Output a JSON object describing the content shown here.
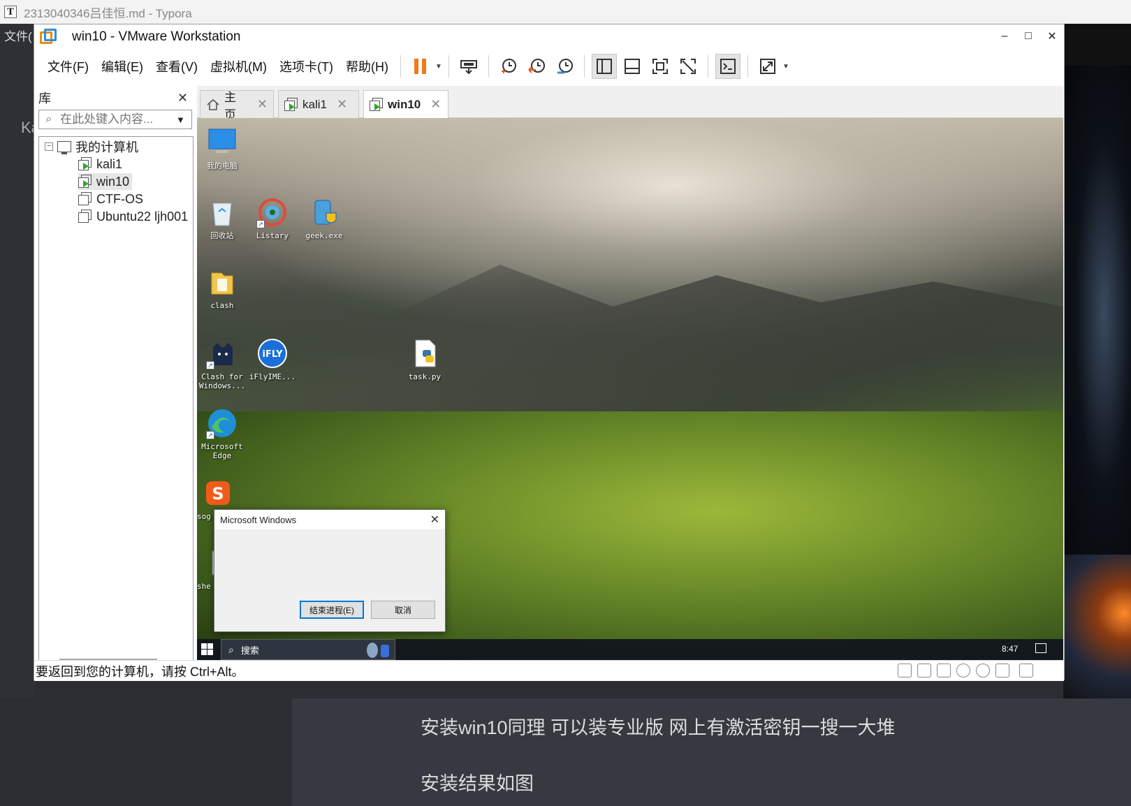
{
  "typora": {
    "window_title": "2313040346吕佳恒.md - Typora",
    "menu_file": "文件(",
    "side_partial": "Ka",
    "doc_line1": "安装win10同理 可以装专业版 网上有激活密钥一搜一大堆",
    "doc_line2": "安装结果如图"
  },
  "vmware": {
    "title": "win10 - VMware Workstation",
    "window_controls": {
      "minimize": "–",
      "maximize": "□",
      "close": "✕"
    },
    "menu": [
      "文件(F)",
      "编辑(E)",
      "查看(V)",
      "虚拟机(M)",
      "选项卡(T)",
      "帮助(H)"
    ],
    "toolbar_icons": [
      "pause-icon",
      "send-ctrl-alt-del-icon",
      "snapshot-take-icon",
      "snapshot-revert-icon",
      "snapshot-manager-icon",
      "show-library-icon",
      "thumbnail-bar-icon",
      "full-screen-icon",
      "unity-icon",
      "console-view-icon",
      "stretch-guest-icon"
    ],
    "library": {
      "title": "库",
      "close": "✕",
      "search_placeholder": "在此处键入内容...",
      "tree": {
        "root": "我的计算机",
        "items": [
          {
            "label": "kali1",
            "running": true
          },
          {
            "label": "win10",
            "running": true,
            "selected": true
          },
          {
            "label": "CTF-OS",
            "running": false
          },
          {
            "label": "Ubuntu22 ljh001",
            "running": false
          }
        ]
      }
    },
    "tabs": [
      {
        "label": "主页",
        "icon": "home-icon",
        "active": false
      },
      {
        "label": "kali1",
        "icon": "vm-running-icon",
        "active": false
      },
      {
        "label": "win10",
        "icon": "vm-running-icon",
        "active": true
      }
    ],
    "tab_close": "✕",
    "status_text": "要返回到您的计算机，请按 Ctrl+Alt。"
  },
  "guest": {
    "desktop_icons": [
      {
        "label": "我的电脑",
        "icon": "this-pc-icon"
      },
      {
        "label": "回收站",
        "icon": "recycle-bin-icon"
      },
      {
        "label": "Listary",
        "icon": "listary-icon"
      },
      {
        "label": "geek.exe",
        "icon": "geek-exe-icon"
      },
      {
        "label": "clash",
        "icon": "folder-icon"
      },
      {
        "label": "Clash for\nWindows...",
        "icon": "clash-icon"
      },
      {
        "label": "iFlyIME...",
        "icon": "iflyime-icon"
      },
      {
        "label": "task.py",
        "icon": "python-file-icon"
      },
      {
        "label": "Microsoft\nEdge",
        "icon": "edge-icon"
      },
      {
        "label": "sog",
        "icon": "sogou-icon"
      },
      {
        "label": "she",
        "icon": "shell-icon"
      }
    ],
    "dialog": {
      "title": "Microsoft Windows",
      "close": "✕",
      "end_process": "结束进程(E)",
      "cancel": "取消"
    },
    "taskbar": {
      "search_label": "搜索",
      "clock": "8:47"
    }
  }
}
